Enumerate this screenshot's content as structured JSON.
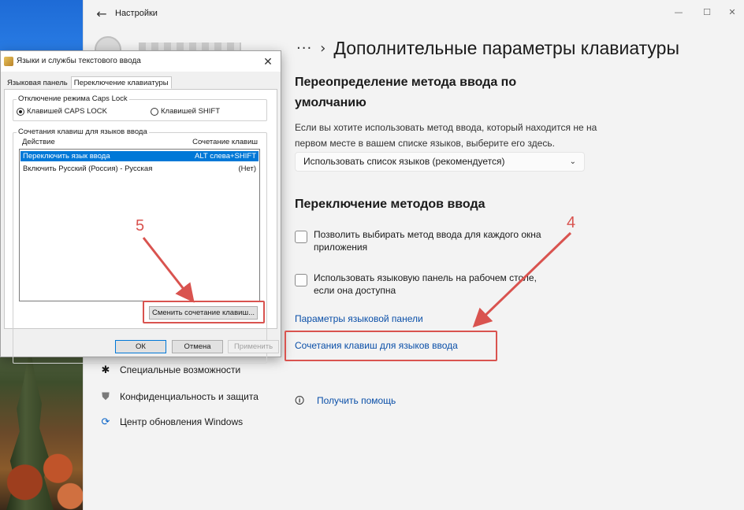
{
  "settings": {
    "app_title": "Настройки",
    "breadcrumb_dots": "···",
    "page_title": "Дополнительные параметры клавиатуры",
    "section1_heading_line1": "Переопределение метода ввода по",
    "section1_heading_line2": "умолчанию",
    "section1_desc_line1": "Если вы хотите использовать метод ввода, который находится не на",
    "section1_desc_line2": "первом месте в вашем списке языков, выберите его здесь.",
    "input_method_dropdown": "Использовать список языков (рекомендуется)",
    "section2_heading": "Переключение методов ввода",
    "checkbox1_label": "Позволить выбирать метод ввода для каждого окна приложения",
    "checkbox2_label": "Использовать языковую панель на рабочем столе, если она доступна",
    "link_language_bar": "Параметры языковой панели",
    "link_hotkeys": "Сочетания клавиш для языков ввода",
    "help_link": "Получить помощь",
    "nav": [
      {
        "label": "Специальные возможности",
        "icon": "accessibility-icon"
      },
      {
        "label": "Конфиденциальность и защита",
        "icon": "shield-icon"
      },
      {
        "label": "Центр обновления Windows",
        "icon": "update-icon"
      }
    ]
  },
  "dialog": {
    "title": "Языки и службы текстового ввода",
    "tabs": [
      "Языковая панель",
      "Переключение клавиатуры"
    ],
    "capslock_group_title": "Отключение режима Caps Lock",
    "radio_capslock": "Клавишей CAPS LOCK",
    "radio_shift": "Клавишей SHIFT",
    "hotkeys_group_title": "Сочетания клавиш для языков ввода",
    "col_action": "Действие",
    "col_shortcut": "Сочетание клавиш",
    "rows": [
      {
        "action": "Переключить язык ввода",
        "shortcut": "ALT слева+SHIFT"
      },
      {
        "action": "Включить Русский (Россия) - Русская",
        "shortcut": "(Нет)"
      }
    ],
    "change_button": "Сменить сочетание клавиш...",
    "ok_button": "ОК",
    "cancel_button": "Отмена",
    "apply_button": "Применить"
  },
  "annotations": {
    "step4": "4",
    "step5": "5",
    "color": "#d9534f"
  }
}
